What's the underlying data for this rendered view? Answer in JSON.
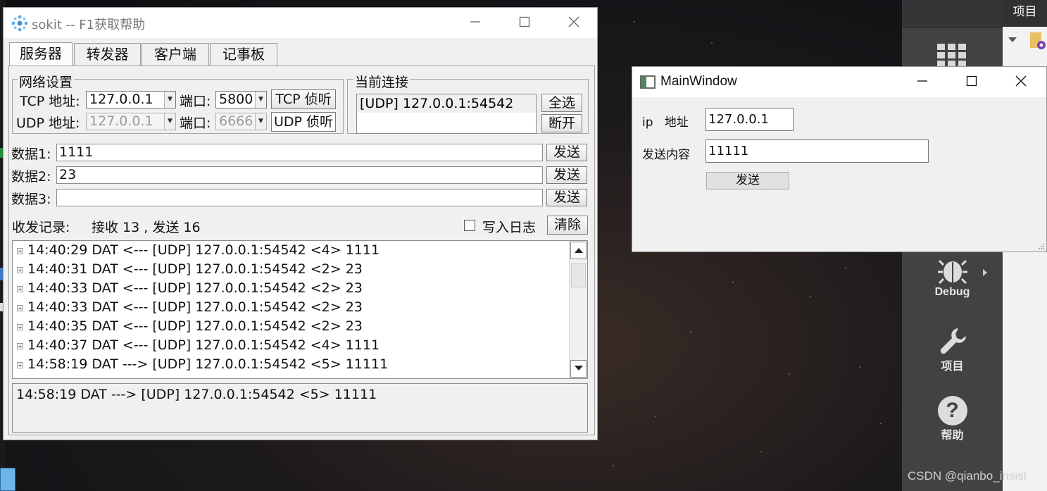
{
  "sokit": {
    "title": "sokit -- F1获取帮助",
    "tabs": [
      "服务器",
      "转发器",
      "客户端",
      "记事板"
    ],
    "network": {
      "group_label": "网络设置",
      "tcp_label": "TCP 地址:",
      "tcp_addr": "127.0.0.1",
      "port_label": "端口:",
      "tcp_port": "5800",
      "tcp_listen": "TCP 侦听",
      "udp_label": "UDP 地址:",
      "udp_addr": "127.0.0.1",
      "udp_port": "6666",
      "udp_listen": "UDP 侦听"
    },
    "connections": {
      "group_label": "当前连接",
      "items": [
        "[UDP] 127.0.0.1:54542"
      ],
      "select_all": "全选",
      "disconnect": "断开"
    },
    "data": [
      {
        "label": "数据1:",
        "value": "1111",
        "send": "发送"
      },
      {
        "label": "数据2:",
        "value": "23",
        "send": "发送"
      },
      {
        "label": "数据3:",
        "value": "",
        "send": "发送"
      }
    ],
    "records": {
      "label": "收发记录:",
      "stats": "接收 13 , 发送 16",
      "write_log": "写入日志",
      "write_log_checked": false,
      "clear": "清除"
    },
    "log": [
      "14:40:29 DAT <--- [UDP] 127.0.0.1:54542 <4> 1111",
      "14:40:31 DAT <--- [UDP] 127.0.0.1:54542 <2> 23",
      "14:40:33 DAT <--- [UDP] 127.0.0.1:54542 <2> 23",
      "14:40:33 DAT <--- [UDP] 127.0.0.1:54542 <2> 23",
      "14:40:35 DAT <--- [UDP] 127.0.0.1:54542 <2> 23",
      "14:40:37 DAT <--- [UDP] 127.0.0.1:54542 <4> 1111",
      "14:58:19 DAT ---> [UDP] 127.0.0.1:54542 <5> 11111"
    ],
    "detail": "14:58:19 DAT ---> [UDP] 127.0.0.1:54542 <5> 11111"
  },
  "mainwindow": {
    "title": "MainWindow",
    "ip_label": "ip   地址",
    "ip_value": "127.0.0.1",
    "content_label": "发送内容",
    "content_value": "11111",
    "send": "发送"
  },
  "qtcreator": {
    "debug_label": "Debug",
    "project_label": "项目",
    "help_label": "帮助",
    "panel_header": "项目",
    "help_glyph": "?"
  },
  "watermark": "CSDN @qianbo_insist",
  "colors": {
    "qt_sidebar": "#404244",
    "window_bg": "#f0f0f0",
    "mw_icon_green": "#4b8a5a"
  }
}
